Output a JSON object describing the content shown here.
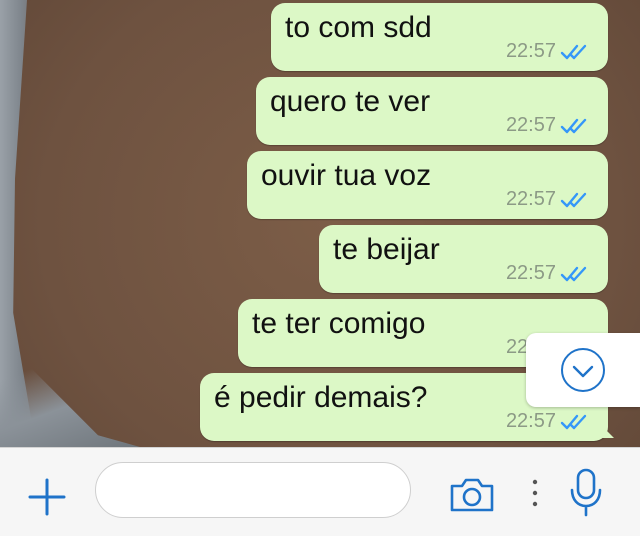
{
  "colors": {
    "bubble_out": "#dcf8c6",
    "accent": "#1f73c9",
    "read_check": "#3497f9",
    "time_text": "#8c9a86"
  },
  "messages": [
    {
      "text": "to com sdd",
      "time": "22:57",
      "status": "read"
    },
    {
      "text": "quero te ver",
      "time": "22:57",
      "status": "read"
    },
    {
      "text": "ouvir tua voz",
      "time": "22:57",
      "status": "read"
    },
    {
      "text": "te beijar",
      "time": "22:57",
      "status": "read"
    },
    {
      "text": "te ter comigo",
      "time": "22:57",
      "status": "read"
    },
    {
      "text": "é pedir demais?",
      "time": "22:57",
      "status": "read"
    }
  ],
  "scroll_button": {
    "icon": "chevron-down-icon"
  },
  "input_bar": {
    "plus_icon": "plus-icon",
    "message_placeholder": "",
    "camera_icon": "camera-icon",
    "more_icon": "vertical-dots-icon",
    "mic_icon": "microphone-icon"
  }
}
